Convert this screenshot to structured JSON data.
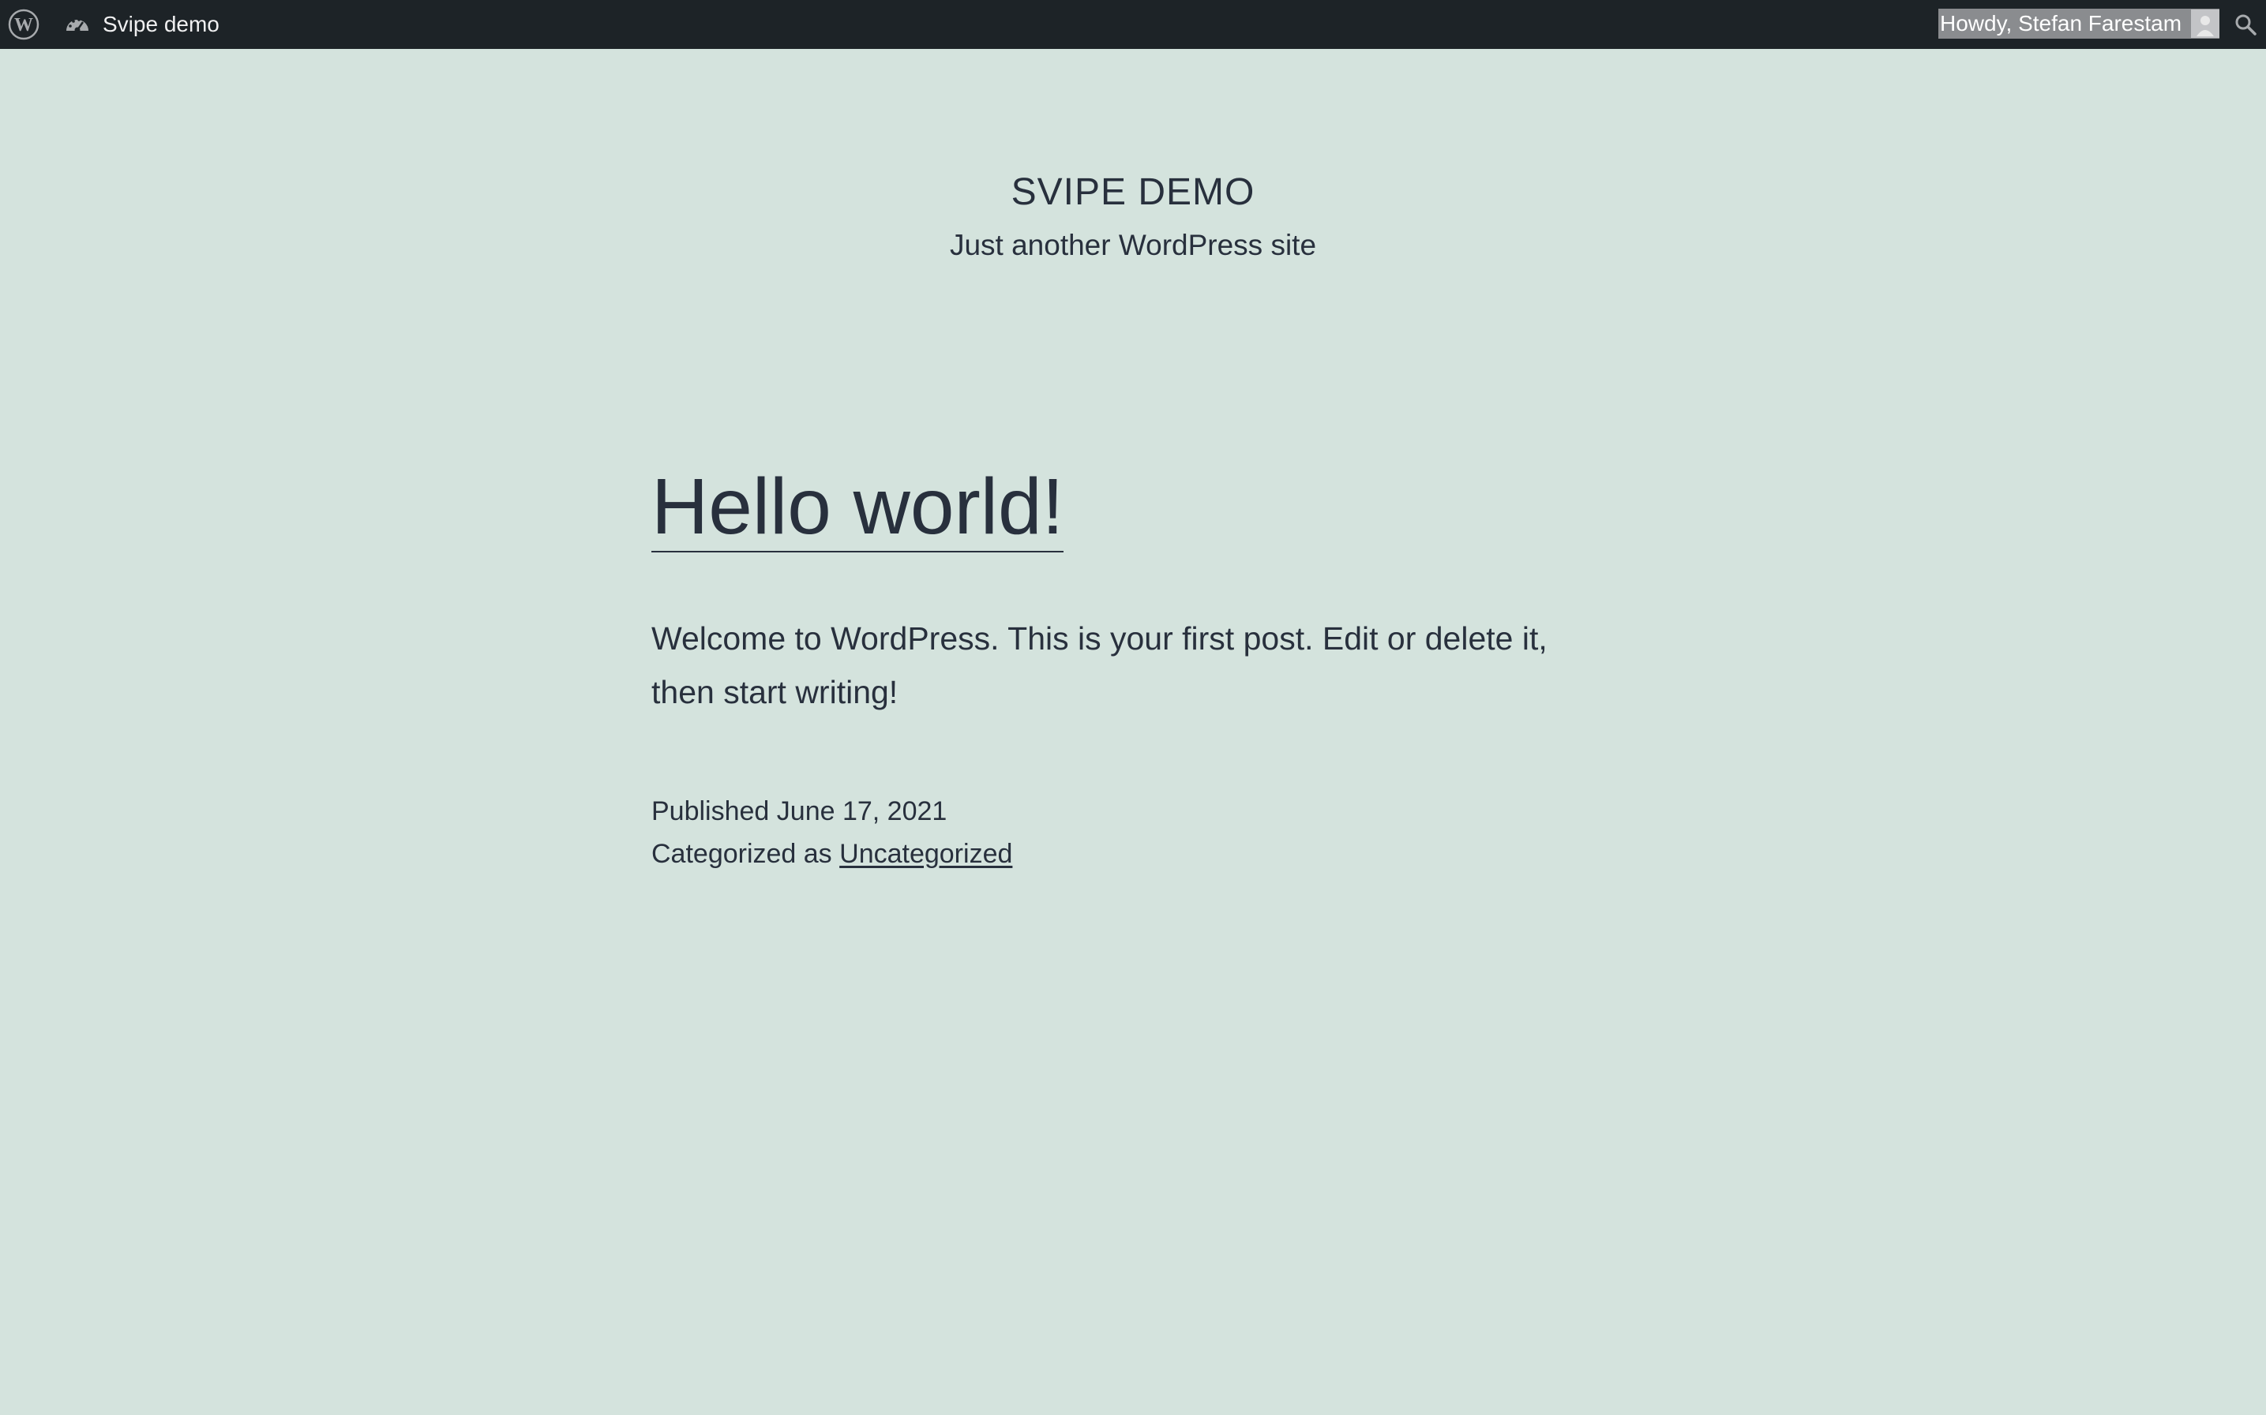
{
  "admin_bar": {
    "site_name": "Svipe demo",
    "account_greeting": "Howdy, Stefan Farestam"
  },
  "icons": {
    "wp_logo": "wordpress-logo-icon",
    "dashboard": "dashboard-icon",
    "avatar": "user-avatar-icon",
    "search": "search-icon"
  },
  "header": {
    "title": "SVIPE DEMO",
    "description": "Just another WordPress site"
  },
  "post": {
    "title": "Hello world!",
    "content": "Welcome to WordPress. This is your first post. Edit or delete it, then start writing!",
    "published_label": "Published",
    "published_date": "June 17, 2021",
    "category_label": "Categorized as",
    "category": "Uncategorized"
  },
  "colors": {
    "admin_bar_bg": "#1d2327",
    "page_bg": "#d4e3dd",
    "text": "#28303d"
  }
}
